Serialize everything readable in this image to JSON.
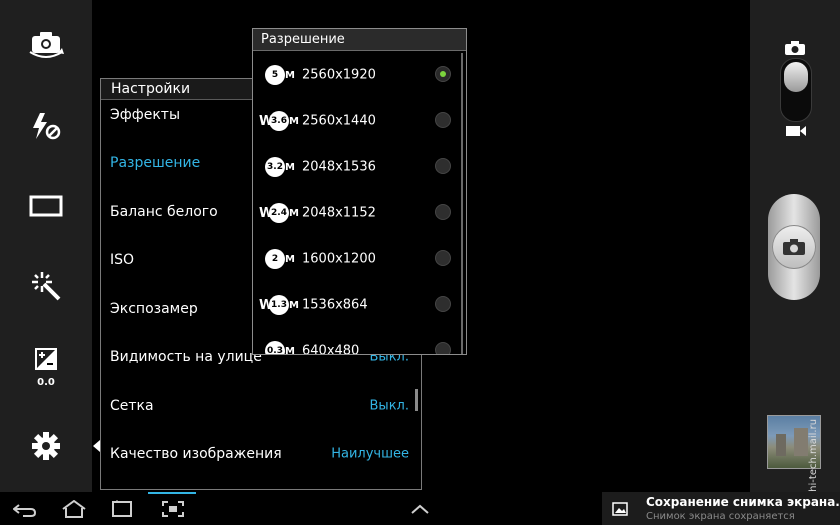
{
  "left_toolbar": {
    "buttons": [
      {
        "name": "self-portrait-icon"
      },
      {
        "name": "flash-off-icon"
      },
      {
        "name": "shooting-mode-icon"
      },
      {
        "name": "scene-mode-icon"
      },
      {
        "name": "exposure-icon",
        "value": "0.0"
      },
      {
        "name": "settings-gear-icon"
      }
    ]
  },
  "settings_panel": {
    "title": "Настройки",
    "rows": [
      {
        "label": "Эффекты",
        "value": "",
        "active": false
      },
      {
        "label": "Разрешение",
        "value": "",
        "active": true
      },
      {
        "label": "Баланс белого",
        "value": "",
        "active": false
      },
      {
        "label": "ISO",
        "value": "",
        "active": false
      },
      {
        "label": "Экспозамер",
        "value": "",
        "active": false
      },
      {
        "label": "Видимость на улице",
        "value": "Выкл.",
        "active": false
      },
      {
        "label": "Сетка",
        "value": "Выкл.",
        "active": false
      },
      {
        "label": "Качество изображения",
        "value": "Наилучшее",
        "active": false
      }
    ]
  },
  "resolution_popup": {
    "title": "Разрешение",
    "options": [
      {
        "mp": "5",
        "wide": false,
        "label": "2560x1920",
        "selected": true
      },
      {
        "mp": "3.6",
        "wide": true,
        "label": "2560x1440",
        "selected": false
      },
      {
        "mp": "3.2",
        "wide": false,
        "label": "2048x1536",
        "selected": false
      },
      {
        "mp": "2.4",
        "wide": true,
        "label": "2048x1152",
        "selected": false
      },
      {
        "mp": "2",
        "wide": false,
        "label": "1600x1200",
        "selected": false
      },
      {
        "mp": "1.3",
        "wide": true,
        "label": "1536x864",
        "selected": false
      },
      {
        "mp": "0.3",
        "wide": false,
        "label": "640x480",
        "selected": false
      }
    ]
  },
  "right_panel": {
    "mode": "camera",
    "thumbnail": "last-photo"
  },
  "watermark": "© hi-tech.mail.ru",
  "notification": {
    "title": "Сохранение снимка экрана...",
    "subtitle": "Снимок экрана сохраняется"
  },
  "colors": {
    "accent": "#33b5e5",
    "radio_on": "#7cd43d"
  }
}
